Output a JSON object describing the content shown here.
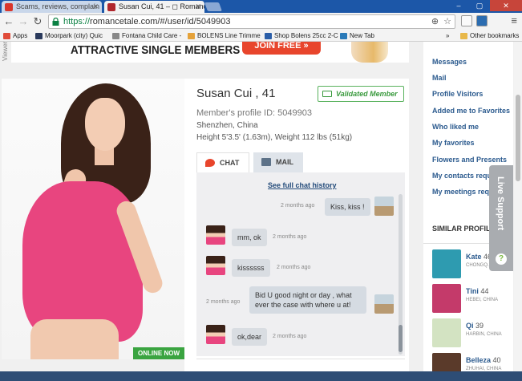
{
  "browser": {
    "tabs": [
      {
        "title": "Scams, reviews, complain",
        "favicon_color": "#d9362b"
      },
      {
        "title": "Susan Cui, 41 – ◻ Romance",
        "favicon_color": "#b0272d"
      }
    ],
    "url_scheme": "https://",
    "url_rest": "romancetale.com/#/user/id/5049903",
    "bookmarks": [
      {
        "label": "Apps",
        "color": "#e04b3a"
      },
      {
        "label": "Moorpark (city) Quic",
        "color": "#2a3a5c"
      },
      {
        "label": "Fontana Child Care -",
        "color": "#888888"
      },
      {
        "label": "BOLENS Line Trimme",
        "color": "#e5a23a"
      },
      {
        "label": "Shop Bolens 25cc 2-C",
        "color": "#2b5ea8"
      },
      {
        "label": "New Tab",
        "color": "#2b7bb9"
      }
    ],
    "bookmarks_overflow": "»",
    "other_bookmarks": "Other bookmarks"
  },
  "banner": {
    "headline": "ATTRACTIVE SINGLE MEMBERS",
    "cta": "JOIN FREE »",
    "side_text": "Viewers"
  },
  "profile": {
    "name": "Susan Cui",
    "age": ", 41",
    "validated": "Validated Member",
    "member_id": "Member's profile ID: 5049903",
    "location": "Shenzhen, China",
    "stats": "Height 5'3.5' (1.63m), Weight 112 lbs (51kg)",
    "online_badge": "ONLINE NOW"
  },
  "chat": {
    "tab_chat": "CHAT",
    "tab_mail": "MAIL",
    "history_link": "See full chat history",
    "messages": [
      {
        "from": "me",
        "text": "Kiss, kiss !",
        "time": "2 months ago"
      },
      {
        "from": "her",
        "text": "mm, ok",
        "time": "2 months ago"
      },
      {
        "from": "her",
        "text": "kissssss",
        "time": "2 months ago"
      },
      {
        "from": "me",
        "text": "Bid U good night or day , what ever the case with where u at!",
        "time": "2 months ago"
      },
      {
        "from": "her",
        "text": "ok,dear",
        "time": "2 months ago"
      }
    ]
  },
  "sidebar": {
    "links": [
      "Messages",
      "Mail",
      "Profile Visitors",
      "Added me to Favorites",
      "Who liked me",
      "My favorites",
      "Flowers and Presents",
      "My contacts reque",
      "My meetings reque"
    ]
  },
  "live_support": {
    "label": "Live Support",
    "icon": "?"
  },
  "similar": {
    "heading": "SIMILAR PROFILE",
    "items": [
      {
        "name": "Kate",
        "age": "46",
        "location": "CHONGQ...",
        "color": "#2e9bb0"
      },
      {
        "name": "Tini",
        "age": "44",
        "location": "HEBEI, CHINA",
        "color": "#c43a6a"
      },
      {
        "name": "Qi",
        "age": "39",
        "location": "HARBIN, CHINA",
        "color": "#d3e3c2"
      },
      {
        "name": "Belleza",
        "age": "40",
        "location": "ZHUHAI, CHINA",
        "color": "#5a3a2a"
      }
    ]
  }
}
